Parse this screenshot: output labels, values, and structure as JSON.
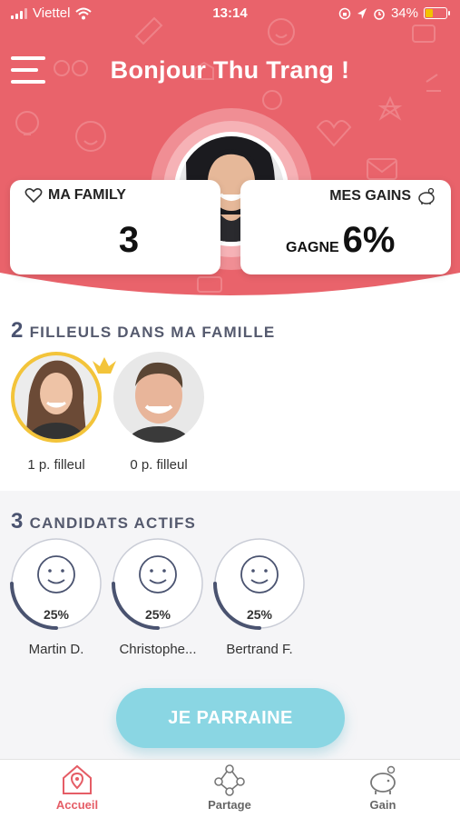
{
  "status_bar": {
    "carrier": "Viettel",
    "time": "13:14",
    "battery": "34%"
  },
  "header": {
    "greeting": "Bonjour Thu Trang !"
  },
  "family_card": {
    "label": "MA FAMILY",
    "value": "3"
  },
  "gains_card": {
    "label": "MES GAINS",
    "prefix": "GAGNE",
    "value": "6%"
  },
  "filleuls": {
    "count": "2",
    "title": "FILLEULS DANS MA FAMILLE",
    "people": [
      {
        "caption": "1 p. filleul",
        "highlighted": true
      },
      {
        "caption": "0 p. filleul",
        "highlighted": false
      }
    ]
  },
  "candidats": {
    "count": "3",
    "title": "CANDIDATS ACTIFS",
    "items": [
      {
        "name": "Martin D.",
        "progress": "25%",
        "progress_fraction": 0.25
      },
      {
        "name": "Christophe...",
        "progress": "25%",
        "progress_fraction": 0.25
      },
      {
        "name": "Bertrand F.",
        "progress": "25%",
        "progress_fraction": 0.25
      }
    ]
  },
  "cta": {
    "label": "JE PARRAINE"
  },
  "tabs": [
    {
      "label": "Accueil",
      "icon": "home-icon",
      "active": true
    },
    {
      "label": "Partage",
      "icon": "share-icon",
      "active": false
    },
    {
      "label": "Gain",
      "icon": "piggy-bank-icon",
      "active": false
    }
  ],
  "colors": {
    "brand": "#e9636b",
    "accent": "#8ad6e3",
    "crown": "#f3c43a",
    "ring": "#4a5370"
  }
}
